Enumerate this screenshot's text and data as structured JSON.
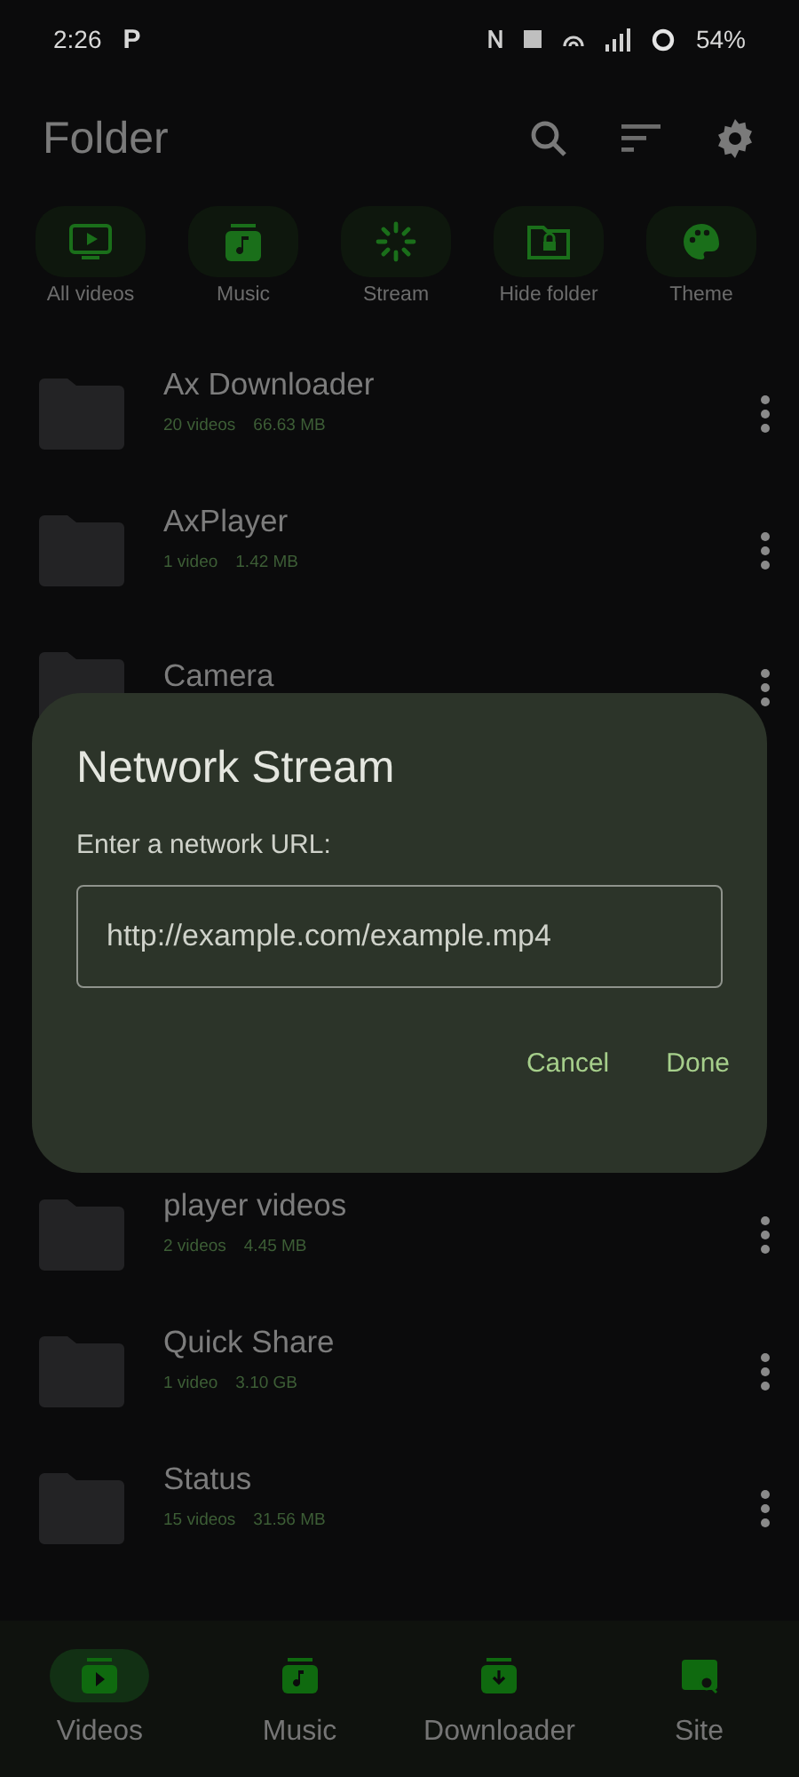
{
  "status_bar": {
    "time": "2:26",
    "carrier_badge": "P",
    "battery": "54%"
  },
  "header": {
    "title": "Folder"
  },
  "shortcuts": [
    {
      "kind": "tv",
      "label": "All videos"
    },
    {
      "kind": "music",
      "label": "Music"
    },
    {
      "kind": "stream",
      "label": "Stream"
    },
    {
      "kind": "folder-lock",
      "label": "Hide folder"
    },
    {
      "kind": "palette",
      "label": "Theme"
    }
  ],
  "folders_top": [
    {
      "name": "Ax Downloader",
      "count": "20 videos",
      "size": "66.63 MB"
    },
    {
      "name": "AxPlayer",
      "count": "1 video",
      "size": "1.42 MB"
    },
    {
      "name": "Camera"
    }
  ],
  "folders_bottom": [
    {
      "name": "player videos",
      "count": "2 videos",
      "size": "4.45 MB"
    },
    {
      "name": "Quick Share",
      "count": "1 video",
      "size": "3.10 GB"
    },
    {
      "name": "Status",
      "count": "15 videos",
      "size": "31.56 MB"
    }
  ],
  "dialog": {
    "title": "Network Stream",
    "label": "Enter a network URL:",
    "placeholder": "http://example.com/example.mp4",
    "buttons": [
      "Cancel",
      "Done"
    ]
  },
  "bottom_nav": [
    {
      "kind": "video",
      "label": "Videos",
      "selected": true
    },
    {
      "kind": "music",
      "label": "Music",
      "selected": false
    },
    {
      "kind": "download",
      "label": "Downloader",
      "selected": false
    },
    {
      "kind": "site",
      "label": "Site",
      "selected": false
    }
  ]
}
